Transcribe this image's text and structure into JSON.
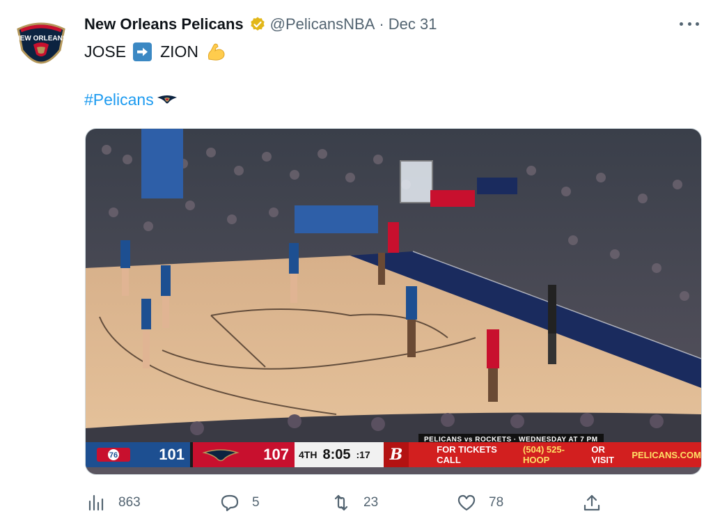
{
  "tweet": {
    "author": {
      "name": "New Orleans Pelicans",
      "handle": "@PelicansNBA",
      "date": "Dec 31",
      "avatar_icon": "pelicans-logo-icon",
      "verified_icon": "verified-badge-icon"
    },
    "text": {
      "first": "JOSE",
      "arrow_icon": "right-arrow-emoji-icon",
      "second": "ZION",
      "muscle_icon": "flexed-biceps-emoji-icon",
      "hashtag": "#Pelicans",
      "hashflag_icon": "pelicans-hashflag-icon"
    },
    "media": {
      "scoreboard": {
        "home_score": "101",
        "away_score": "107",
        "quarter": "4TH",
        "clock": "8:05",
        "shot_clock": ":17",
        "promo_text": "FOR TICKETS CALL",
        "promo_phone": "(504) 525-HOOP",
        "promo_or": "OR VISIT",
        "promo_site": "PELICANS.COM",
        "ticker": "PELICANS vs ROCKETS · WEDNESDAY AT 7 PM"
      }
    },
    "actions": {
      "views": "863",
      "replies": "5",
      "retweets": "23",
      "likes": "78"
    },
    "colors": {
      "accent": "#1d9bf0",
      "secondary_text": "#536471",
      "verified": "#e2b719"
    }
  }
}
